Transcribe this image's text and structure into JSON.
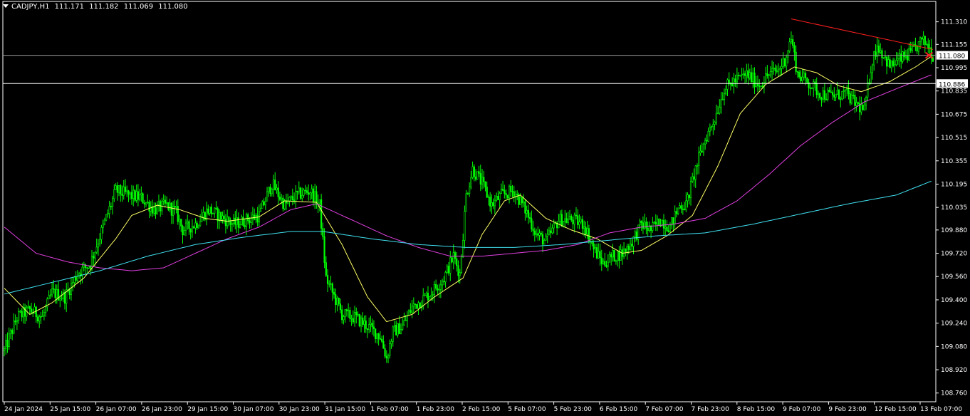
{
  "header": {
    "symbol": "CADJPY,H1",
    "open": "111.171",
    "high": "111.182",
    "low": "111.069",
    "close": "111.080"
  },
  "colors": {
    "background": "#000000",
    "candle": "#00ff00",
    "axis_text": "#ffffff",
    "ma_fast": "#ffff66",
    "ma_mid": "#e040e0",
    "ma_slow": "#40e0f0",
    "trendline": "#ff2020",
    "hline": "#c8c8c8"
  },
  "chart_data": {
    "type": "candlestick",
    "symbol": "CADJPY",
    "timeframe": "H1",
    "ylim": [
      108.7,
      111.45
    ],
    "y_ticks": [
      "111.310",
      "111.155",
      "110.995",
      "110.835",
      "110.675",
      "110.515",
      "110.355",
      "110.195",
      "110.035",
      "109.880",
      "109.720",
      "109.560",
      "109.400",
      "109.240",
      "109.080",
      "108.920",
      "108.760"
    ],
    "x_ticks": [
      "24 Jan 2024",
      "25 Jan 15:00",
      "26 Jan 07:00",
      "26 Jan 23:00",
      "29 Jan 15:00",
      "30 Jan 07:00",
      "30 Jan 23:00",
      "31 Jan 15:00",
      "1 Feb 07:00",
      "1 Feb 23:00",
      "2 Feb 15:00",
      "5 Feb 07:00",
      "5 Feb 23:00",
      "6 Feb 15:00",
      "7 Feb 07:00",
      "7 Feb 23:00",
      "8 Feb 15:00",
      "9 Feb 07:00",
      "9 Feb 23:00",
      "12 Feb 15:00",
      "13 Feb 07:00"
    ],
    "horizontal_lines": [
      {
        "price": 111.08,
        "label": "111.080",
        "style": "price"
      },
      {
        "price": 110.886,
        "label": "110.886",
        "style": "level"
      }
    ],
    "price_path": [
      [
        0,
        109.05
      ],
      [
        8,
        109.28
      ],
      [
        16,
        109.33
      ],
      [
        24,
        109.28
      ],
      [
        30,
        109.45
      ],
      [
        38,
        109.42
      ],
      [
        46,
        109.58
      ],
      [
        54,
        109.65
      ],
      [
        62,
        109.9
      ],
      [
        70,
        110.15
      ],
      [
        78,
        110.12
      ],
      [
        86,
        110.1
      ],
      [
        94,
        110.02
      ],
      [
        102,
        110.05
      ],
      [
        108,
        110.0
      ],
      [
        112,
        109.88
      ],
      [
        120,
        109.92
      ],
      [
        128,
        110.02
      ],
      [
        136,
        109.97
      ],
      [
        144,
        109.92
      ],
      [
        152,
        109.95
      ],
      [
        160,
        109.98
      ],
      [
        168,
        110.2
      ],
      [
        176,
        110.05
      ],
      [
        184,
        110.12
      ],
      [
        192,
        110.15
      ],
      [
        198,
        110.05
      ],
      [
        202,
        109.55
      ],
      [
        206,
        109.45
      ],
      [
        212,
        109.3
      ],
      [
        220,
        109.28
      ],
      [
        228,
        109.22
      ],
      [
        236,
        109.15
      ],
      [
        240,
        109.0
      ],
      [
        244,
        109.18
      ],
      [
        250,
        109.22
      ],
      [
        256,
        109.35
      ],
      [
        262,
        109.4
      ],
      [
        268,
        109.45
      ],
      [
        276,
        109.55
      ],
      [
        282,
        109.7
      ],
      [
        286,
        109.58
      ],
      [
        290,
        110.12
      ],
      [
        294,
        110.3
      ],
      [
        300,
        110.2
      ],
      [
        306,
        110.05
      ],
      [
        312,
        110.12
      ],
      [
        320,
        110.15
      ],
      [
        328,
        110.0
      ],
      [
        334,
        109.85
      ],
      [
        340,
        109.8
      ],
      [
        348,
        109.95
      ],
      [
        356,
        109.95
      ],
      [
        364,
        109.92
      ],
      [
        370,
        109.75
      ],
      [
        376,
        109.65
      ],
      [
        382,
        109.7
      ],
      [
        388,
        109.72
      ],
      [
        394,
        109.8
      ],
      [
        400,
        109.92
      ],
      [
        406,
        109.88
      ],
      [
        412,
        109.95
      ],
      [
        418,
        109.9
      ],
      [
        424,
        110.05
      ],
      [
        428,
        110.05
      ],
      [
        434,
        110.3
      ],
      [
        440,
        110.5
      ],
      [
        446,
        110.65
      ],
      [
        452,
        110.85
      ],
      [
        458,
        110.9
      ],
      [
        466,
        110.95
      ],
      [
        474,
        110.88
      ],
      [
        480,
        110.95
      ],
      [
        486,
        110.98
      ],
      [
        490,
        111.05
      ],
      [
        494,
        111.2
      ],
      [
        498,
        110.95
      ],
      [
        504,
        110.9
      ],
      [
        512,
        110.82
      ],
      [
        520,
        110.8
      ],
      [
        528,
        110.82
      ],
      [
        534,
        110.75
      ],
      [
        540,
        110.7
      ],
      [
        544,
        111.0
      ],
      [
        548,
        111.15
      ],
      [
        552,
        111.08
      ],
      [
        556,
        111.0
      ],
      [
        562,
        111.05
      ],
      [
        570,
        111.1
      ],
      [
        576,
        111.18
      ],
      [
        580,
        111.15
      ],
      [
        583,
        111.08
      ]
    ],
    "moving_averages": [
      {
        "name": "fast",
        "color": "#ffff66",
        "points": [
          [
            0,
            109.48
          ],
          [
            16,
            109.3
          ],
          [
            30,
            109.38
          ],
          [
            50,
            109.55
          ],
          [
            70,
            109.82
          ],
          [
            80,
            109.98
          ],
          [
            96,
            110.05
          ],
          [
            110,
            110.02
          ],
          [
            126,
            109.96
          ],
          [
            140,
            109.94
          ],
          [
            160,
            109.97
          ],
          [
            176,
            110.08
          ],
          [
            196,
            110.07
          ],
          [
            212,
            109.78
          ],
          [
            228,
            109.42
          ],
          [
            240,
            109.25
          ],
          [
            256,
            109.3
          ],
          [
            270,
            109.42
          ],
          [
            288,
            109.55
          ],
          [
            300,
            109.85
          ],
          [
            314,
            110.08
          ],
          [
            324,
            110.12
          ],
          [
            340,
            109.96
          ],
          [
            356,
            109.88
          ],
          [
            372,
            109.82
          ],
          [
            388,
            109.72
          ],
          [
            400,
            109.74
          ],
          [
            416,
            109.84
          ],
          [
            432,
            109.98
          ],
          [
            448,
            110.32
          ],
          [
            462,
            110.68
          ],
          [
            478,
            110.88
          ],
          [
            496,
            111.0
          ],
          [
            510,
            110.96
          ],
          [
            524,
            110.87
          ],
          [
            538,
            110.83
          ],
          [
            556,
            110.9
          ],
          [
            572,
            111.0
          ],
          [
            583,
            111.08
          ]
        ]
      },
      {
        "name": "mid",
        "color": "#e040e0",
        "points": [
          [
            0,
            109.9
          ],
          [
            20,
            109.72
          ],
          [
            40,
            109.66
          ],
          [
            60,
            109.62
          ],
          [
            80,
            109.6
          ],
          [
            100,
            109.62
          ],
          [
            120,
            109.72
          ],
          [
            140,
            109.82
          ],
          [
            160,
            109.9
          ],
          [
            180,
            110.02
          ],
          [
            196,
            110.06
          ],
          [
            216,
            109.96
          ],
          [
            240,
            109.84
          ],
          [
            260,
            109.76
          ],
          [
            280,
            109.7
          ],
          [
            300,
            109.7
          ],
          [
            320,
            109.72
          ],
          [
            340,
            109.74
          ],
          [
            360,
            109.78
          ],
          [
            380,
            109.86
          ],
          [
            400,
            109.9
          ],
          [
            420,
            109.92
          ],
          [
            440,
            109.96
          ],
          [
            460,
            110.08
          ],
          [
            480,
            110.26
          ],
          [
            500,
            110.46
          ],
          [
            520,
            110.62
          ],
          [
            540,
            110.76
          ],
          [
            560,
            110.85
          ],
          [
            583,
            110.95
          ]
        ]
      },
      {
        "name": "slow",
        "color": "#40e0f0",
        "points": [
          [
            0,
            109.44
          ],
          [
            30,
            109.52
          ],
          [
            60,
            109.6
          ],
          [
            90,
            109.7
          ],
          [
            120,
            109.78
          ],
          [
            150,
            109.83
          ],
          [
            180,
            109.87
          ],
          [
            200,
            109.87
          ],
          [
            230,
            109.82
          ],
          [
            260,
            109.78
          ],
          [
            290,
            109.76
          ],
          [
            320,
            109.76
          ],
          [
            350,
            109.78
          ],
          [
            380,
            109.81
          ],
          [
            410,
            109.84
          ],
          [
            440,
            109.86
          ],
          [
            470,
            109.92
          ],
          [
            500,
            109.99
          ],
          [
            530,
            110.06
          ],
          [
            560,
            110.12
          ],
          [
            583,
            110.22
          ]
        ]
      }
    ],
    "trendline": {
      "from": [
        494,
        111.33
      ],
      "to": [
        583,
        111.12
      ],
      "color": "#ff2020"
    },
    "n_bars": 584,
    "grid": false
  }
}
